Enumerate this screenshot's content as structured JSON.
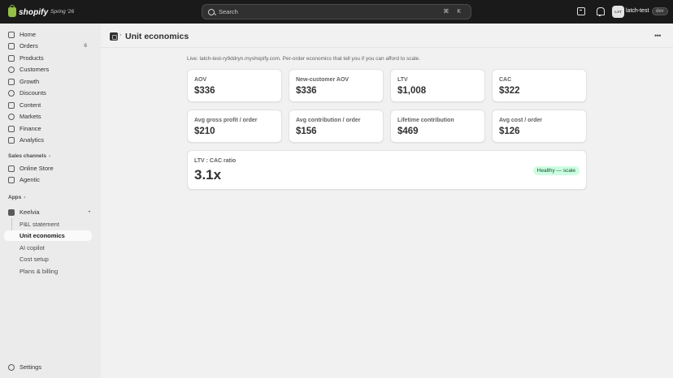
{
  "topbar": {
    "logo_text": "shopify",
    "edition": "Spring '26",
    "search_placeholder": "Search",
    "search_shortcut": "⌘ K",
    "store_initials": "LAT",
    "store_name": "latch-test",
    "env_badge": "dev"
  },
  "sidebar": {
    "nav": [
      {
        "label": "Home"
      },
      {
        "label": "Orders",
        "count": "6"
      },
      {
        "label": "Products"
      },
      {
        "label": "Customers"
      },
      {
        "label": "Growth"
      },
      {
        "label": "Discounts"
      },
      {
        "label": "Content"
      },
      {
        "label": "Markets"
      },
      {
        "label": "Finance"
      },
      {
        "label": "Analytics"
      }
    ],
    "sales_channels_heading": "Sales channels",
    "sales_channels": [
      {
        "label": "Online Store"
      },
      {
        "label": "Agentic"
      }
    ],
    "apps_heading": "Apps",
    "app_name": "Keelvia",
    "app_pages": [
      {
        "label": "P&L statement"
      },
      {
        "label": "Unit economics"
      },
      {
        "label": "AI copilot"
      },
      {
        "label": "Cost setup"
      },
      {
        "label": "Plans & billing"
      }
    ],
    "settings_label": "Settings"
  },
  "page": {
    "title": "Unit economics",
    "subtitle": "Live: latch-test-ry9ddryn.myshopify.com. Per-order economics that tell you if you can afford to scale."
  },
  "metrics_row1": [
    {
      "label": "AOV",
      "value": "$336"
    },
    {
      "label": "New-customer AOV",
      "value": "$336"
    },
    {
      "label": "LTV",
      "value": "$1,008"
    },
    {
      "label": "CAC",
      "value": "$322"
    }
  ],
  "metrics_row2": [
    {
      "label": "Avg gross profit / order",
      "value": "$210"
    },
    {
      "label": "Avg contribution / order",
      "value": "$156"
    },
    {
      "label": "Lifetime contribution",
      "value": "$469"
    },
    {
      "label": "Avg cost / order",
      "value": "$126"
    }
  ],
  "ratio": {
    "label": "LTV : CAC ratio",
    "value": "3.1x",
    "status": "Healthy — scale"
  }
}
